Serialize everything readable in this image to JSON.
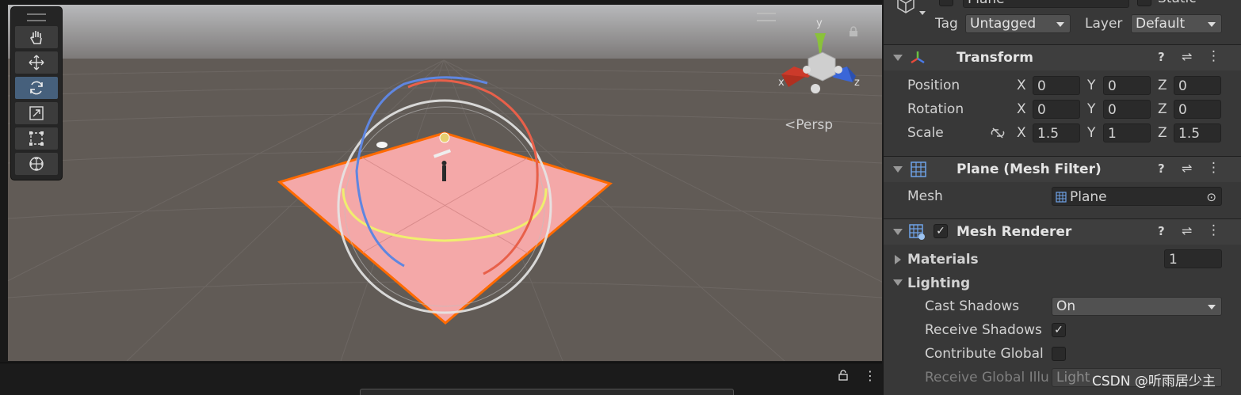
{
  "scene": {
    "view_label": "Persp",
    "axis_labels": {
      "x": "x",
      "y": "y",
      "z": "z"
    },
    "tools": [
      "hand-tool",
      "move-tool",
      "rotate-tool",
      "scale-tool",
      "rect-tool",
      "transform-tool"
    ],
    "active_tool": "rotate-tool"
  },
  "inspector": {
    "header": {
      "name_value": "Plane",
      "static_label": "Static",
      "tag_label": "Tag",
      "tag_value": "Untagged",
      "layer_label": "Layer",
      "layer_value": "Default"
    },
    "transform": {
      "title": "Transform",
      "position_label": "Position",
      "rotation_label": "Rotation",
      "scale_label": "Scale",
      "x": "X",
      "y": "Y",
      "z": "Z",
      "position": {
        "x": "0",
        "y": "0",
        "z": "0"
      },
      "rotation": {
        "x": "0",
        "y": "0",
        "z": "0"
      },
      "scale": {
        "x": "1.5",
        "y": "1",
        "z": "1.5"
      }
    },
    "mesh_filter": {
      "title": "Plane (Mesh Filter)",
      "mesh_label": "Mesh",
      "mesh_value": "Plane"
    },
    "mesh_renderer": {
      "title": "Mesh Renderer",
      "enabled": true,
      "materials_label": "Materials",
      "materials_count": "1",
      "lighting_label": "Lighting",
      "cast_shadows_label": "Cast Shadows",
      "cast_shadows_value": "On",
      "receive_shadows_label": "Receive Shadows",
      "receive_shadows": true,
      "contribute_gi_label": "Contribute Global",
      "contribute_gi": false,
      "receive_gi_label": "Receive Global Illu",
      "receive_gi_value": "Light"
    }
  },
  "watermark": "CSDN @听雨居少主",
  "colors": {
    "plane": "#f4a8a8",
    "plane_outline": "#ff6a00",
    "scene_sky": "#8e8e8e",
    "scene_ground": "#5f5a55",
    "selection_blue": "#46607c"
  }
}
